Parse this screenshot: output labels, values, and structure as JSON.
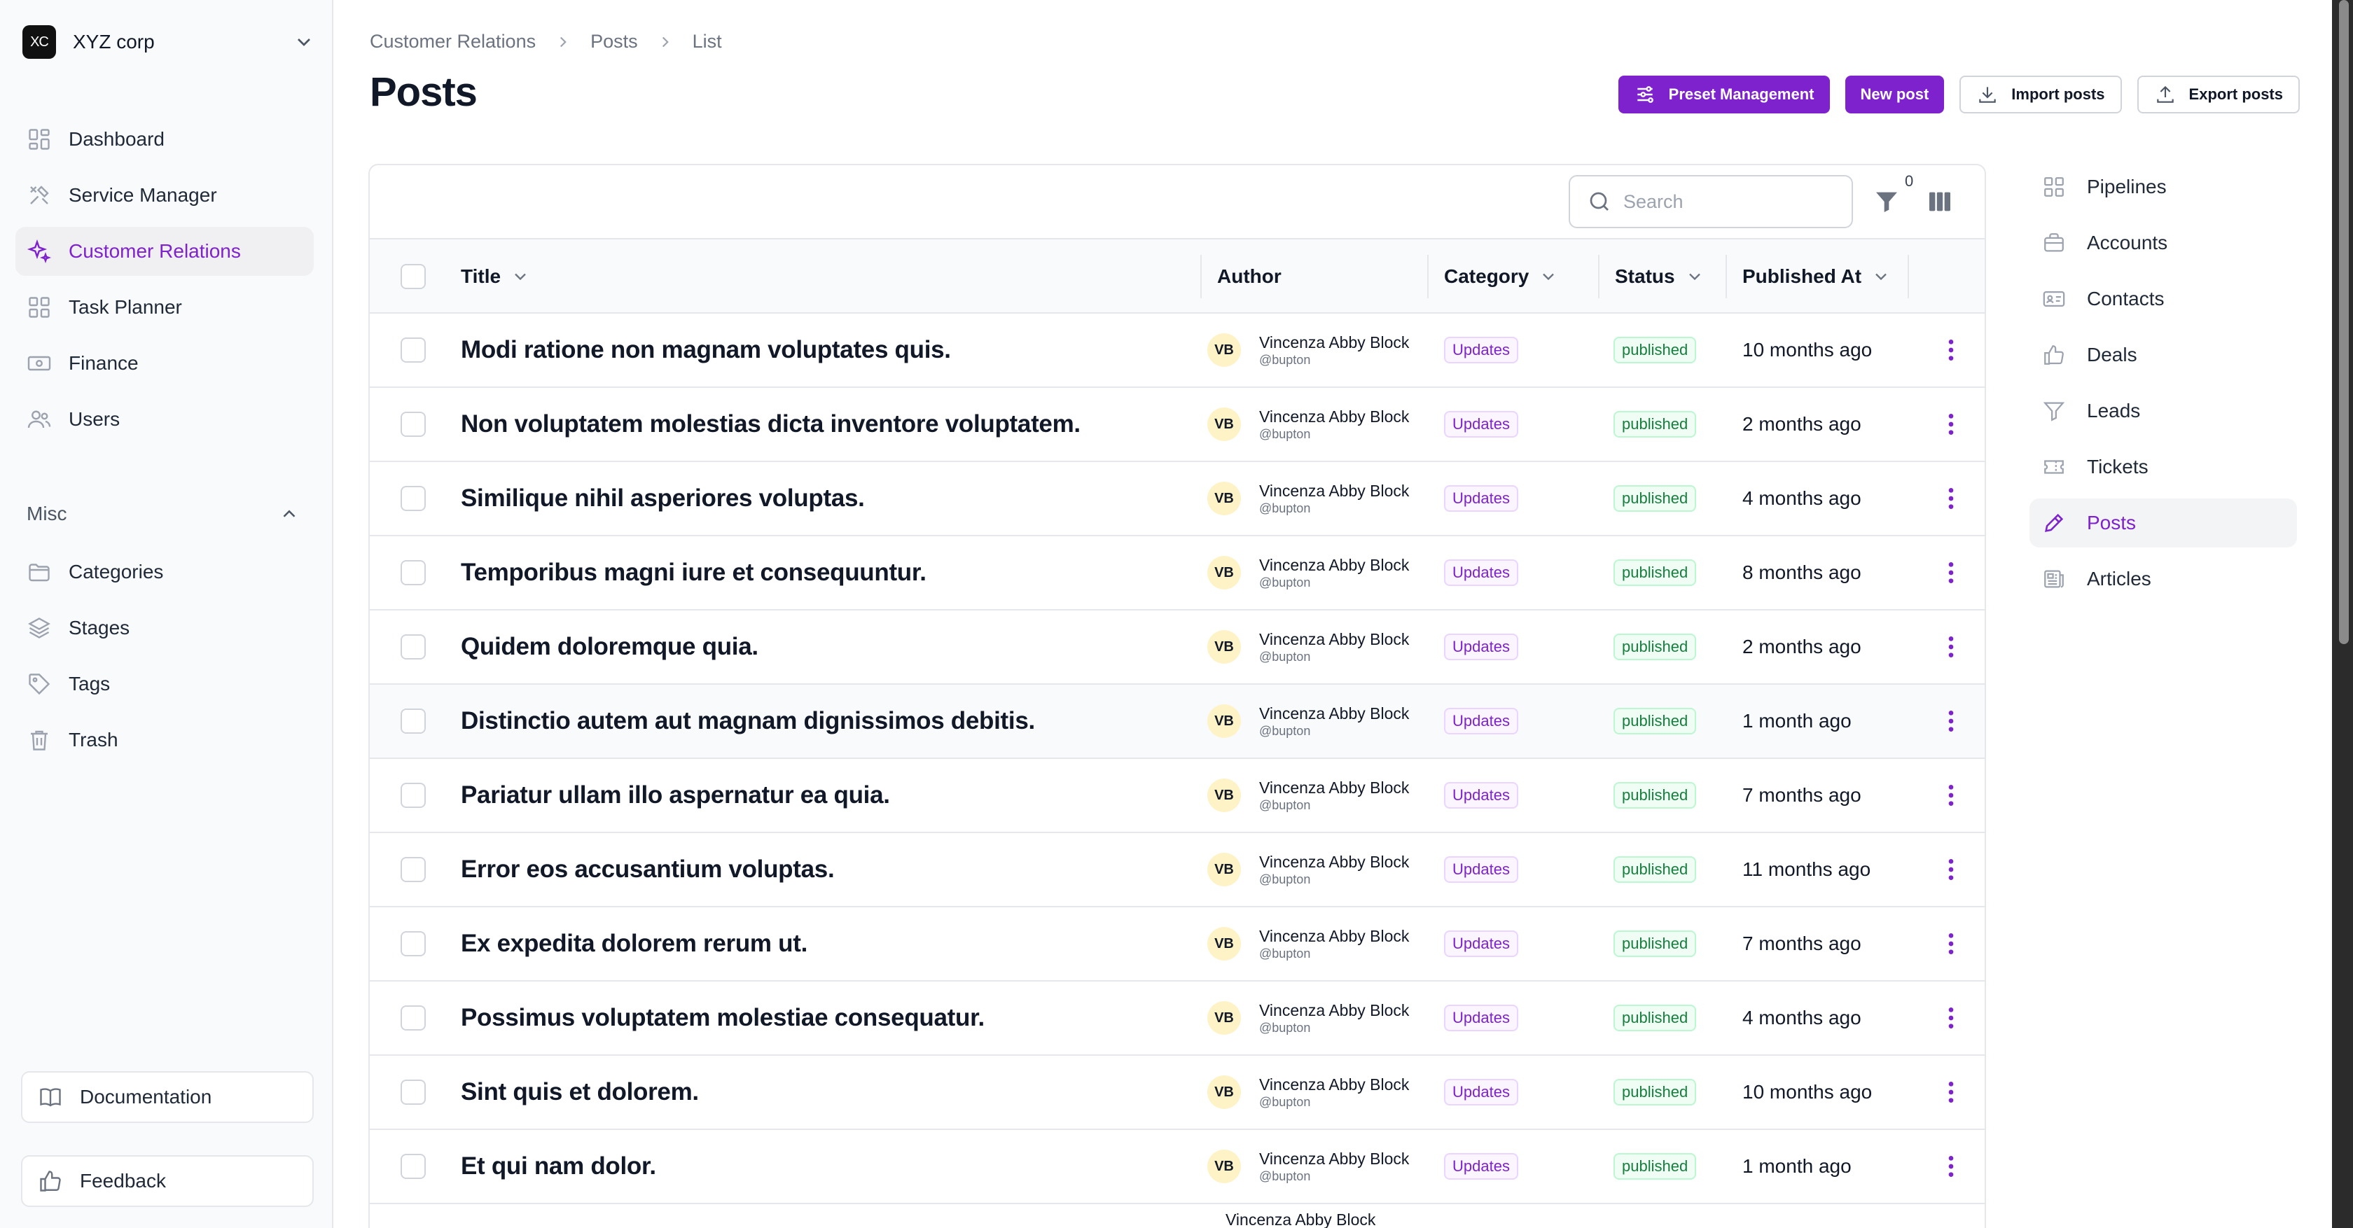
{
  "org": {
    "logo_text": "XC",
    "name": "XYZ corp"
  },
  "sidebar": {
    "items": [
      {
        "label": "Dashboard",
        "icon": "dashboard-icon"
      },
      {
        "label": "Service Manager",
        "icon": "tools-icon"
      },
      {
        "label": "Customer Relations",
        "icon": "sparkles-icon",
        "active": true
      },
      {
        "label": "Task Planner",
        "icon": "grid-icon"
      },
      {
        "label": "Finance",
        "icon": "cash-icon"
      },
      {
        "label": "Users",
        "icon": "users-icon"
      }
    ],
    "misc_label": "Misc",
    "misc_items": [
      {
        "label": "Categories",
        "icon": "folder-icon"
      },
      {
        "label": "Stages",
        "icon": "layers-icon"
      },
      {
        "label": "Tags",
        "icon": "tag-icon"
      },
      {
        "label": "Trash",
        "icon": "trash-icon"
      }
    ],
    "documentation": "Documentation",
    "feedback": "Feedback"
  },
  "breadcrumb": [
    "Customer Relations",
    "Posts",
    "List"
  ],
  "page_title": "Posts",
  "actions": {
    "preset": "Preset Management",
    "new_post": "New post",
    "import": "Import posts",
    "export": "Export posts"
  },
  "toolbar": {
    "search_placeholder": "Search",
    "filter_count": "0"
  },
  "table": {
    "headers": {
      "title": "Title",
      "author": "Author",
      "category": "Category",
      "status": "Status",
      "published": "Published At"
    },
    "rows": [
      {
        "title": "Modi ratione non magnam voluptates quis.",
        "initials": "VB",
        "author": "Vincenza Abby Block",
        "handle": "@bupton",
        "category": "Updates",
        "status": "published",
        "published": "10 months ago"
      },
      {
        "title": "Non voluptatem molestias dicta inventore voluptatem.",
        "initials": "VB",
        "author": "Vincenza Abby Block",
        "handle": "@bupton",
        "category": "Updates",
        "status": "published",
        "published": "2 months ago"
      },
      {
        "title": "Similique nihil asperiores voluptas.",
        "initials": "VB",
        "author": "Vincenza Abby Block",
        "handle": "@bupton",
        "category": "Updates",
        "status": "published",
        "published": "4 months ago"
      },
      {
        "title": "Temporibus magni iure et consequuntur.",
        "initials": "VB",
        "author": "Vincenza Abby Block",
        "handle": "@bupton",
        "category": "Updates",
        "status": "published",
        "published": "8 months ago"
      },
      {
        "title": "Quidem doloremque quia.",
        "initials": "VB",
        "author": "Vincenza Abby Block",
        "handle": "@bupton",
        "category": "Updates",
        "status": "published",
        "published": "2 months ago"
      },
      {
        "title": "Distinctio autem aut magnam dignissimos debitis.",
        "initials": "VB",
        "author": "Vincenza Abby Block",
        "handle": "@bupton",
        "category": "Updates",
        "status": "published",
        "published": "1 month ago"
      },
      {
        "title": "Pariatur ullam illo aspernatur ea quia.",
        "initials": "VB",
        "author": "Vincenza Abby Block",
        "handle": "@bupton",
        "category": "Updates",
        "status": "published",
        "published": "7 months ago"
      },
      {
        "title": "Error eos accusantium voluptas.",
        "initials": "VB",
        "author": "Vincenza Abby Block",
        "handle": "@bupton",
        "category": "Updates",
        "status": "published",
        "published": "11 months ago"
      },
      {
        "title": "Ex expedita dolorem rerum ut.",
        "initials": "VB",
        "author": "Vincenza Abby Block",
        "handle": "@bupton",
        "category": "Updates",
        "status": "published",
        "published": "7 months ago"
      },
      {
        "title": "Possimus voluptatem molestiae consequatur.",
        "initials": "VB",
        "author": "Vincenza Abby Block",
        "handle": "@bupton",
        "category": "Updates",
        "status": "published",
        "published": "4 months ago"
      },
      {
        "title": "Sint quis et dolorem.",
        "initials": "VB",
        "author": "Vincenza Abby Block",
        "handle": "@bupton",
        "category": "Updates",
        "status": "published",
        "published": "10 months ago"
      },
      {
        "title": "Et qui nam dolor.",
        "initials": "VB",
        "author": "Vincenza Abby Block",
        "handle": "@bupton",
        "category": "Updates",
        "status": "published",
        "published": "1 month ago"
      },
      {
        "title": "",
        "initials": "",
        "author": "Vincenza Abby Block",
        "handle": "",
        "category": "",
        "status": "",
        "published": ""
      }
    ]
  },
  "subnav": [
    {
      "label": "Pipelines",
      "icon": "grid-icon"
    },
    {
      "label": "Accounts",
      "icon": "briefcase-icon"
    },
    {
      "label": "Contacts",
      "icon": "id-card-icon"
    },
    {
      "label": "Deals",
      "icon": "thumbs-up-icon"
    },
    {
      "label": "Leads",
      "icon": "funnel-icon"
    },
    {
      "label": "Tickets",
      "icon": "ticket-icon"
    },
    {
      "label": "Posts",
      "icon": "pencil-icon",
      "active": true
    },
    {
      "label": "Articles",
      "icon": "newspaper-icon"
    }
  ],
  "colors": {
    "accent": "#7e22ce",
    "status_green": "#15803d",
    "avatar_bg": "#fef3c7"
  }
}
